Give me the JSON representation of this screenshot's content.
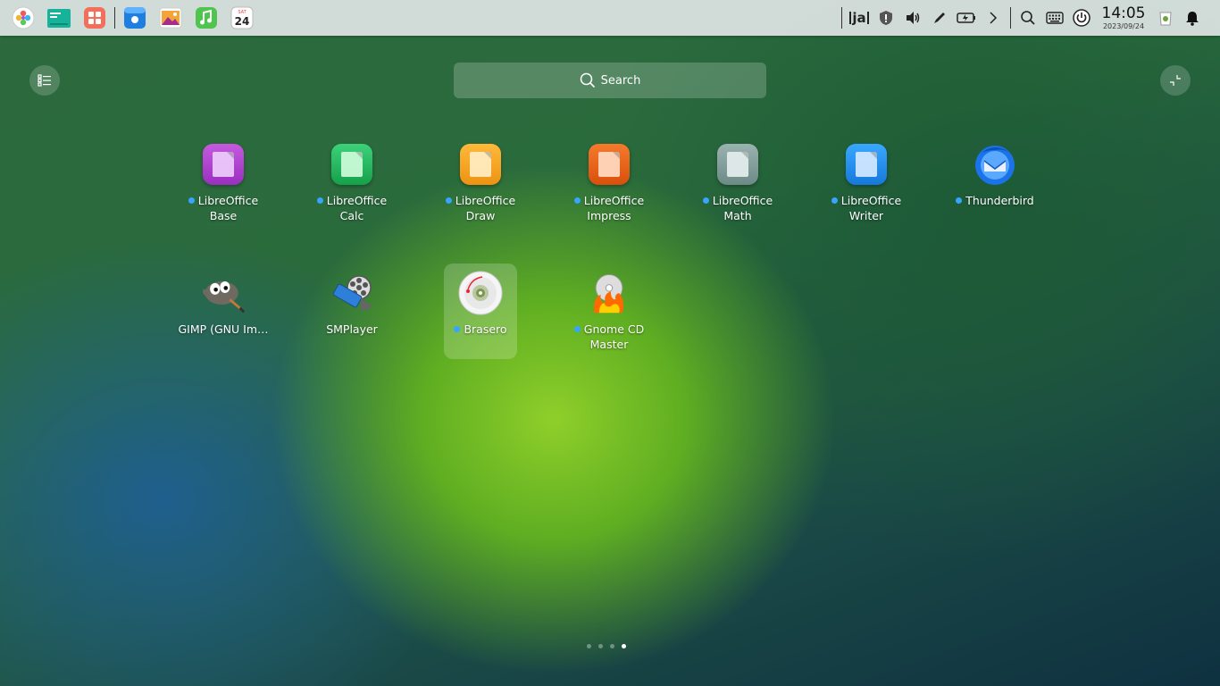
{
  "dock": {
    "apps": [
      {
        "name": "launcher-icon"
      },
      {
        "name": "file-manager-icon"
      },
      {
        "name": "app-store-icon"
      },
      {
        "name": "browser-icon"
      },
      {
        "name": "image-viewer-icon"
      },
      {
        "name": "music-icon"
      },
      {
        "name": "calendar-icon",
        "day": "24",
        "month": "SAT"
      }
    ],
    "tray": {
      "input_method": "ja",
      "time": "14:05",
      "date": "2023/09/24"
    }
  },
  "search": {
    "label": "Search"
  },
  "apps": [
    {
      "line1": "LibreOffice",
      "line2": "Base",
      "color": "#b03fd1",
      "new": true
    },
    {
      "line1": "LibreOffice",
      "line2": "Calc",
      "color": "#20b45a",
      "new": true
    },
    {
      "line1": "LibreOffice",
      "line2": "Draw",
      "color": "#f1a01c",
      "new": true
    },
    {
      "line1": "LibreOffice",
      "line2": "Impress",
      "color": "#e55b14",
      "new": true
    },
    {
      "line1": "LibreOffice",
      "line2": "Math",
      "color": "#7d9a97",
      "new": true
    },
    {
      "line1": "LibreOffice",
      "line2": "Writer",
      "color": "#1d8de8",
      "new": true
    },
    {
      "line1": "Thunderbird",
      "line2": "",
      "new": true
    },
    {
      "line1": "GIMP (GNU Im…",
      "line2": "",
      "new": false
    },
    {
      "line1": "SMPlayer",
      "line2": "",
      "new": false
    },
    {
      "line1": "Brasero",
      "line2": "",
      "new": true
    },
    {
      "line1": "Gnome CD",
      "line2": "Master",
      "new": true
    }
  ],
  "pagination": {
    "pages": 4,
    "current": 4
  }
}
